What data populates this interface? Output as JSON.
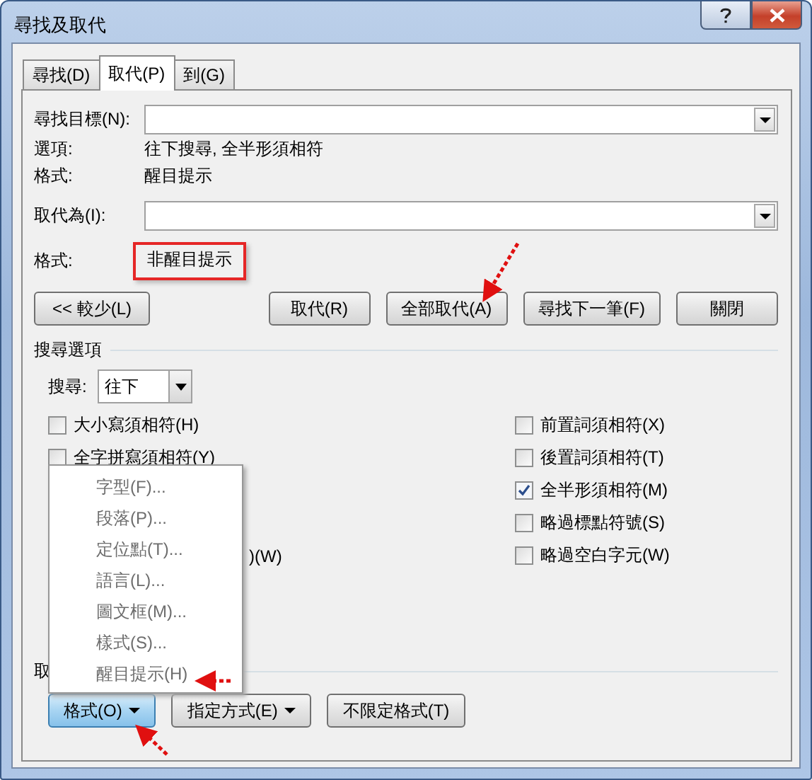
{
  "window": {
    "title": "尋找及取代"
  },
  "tabs": [
    {
      "label": "尋找(D)",
      "selected": false
    },
    {
      "label": "取代(P)",
      "selected": true
    },
    {
      "label": "到(G)",
      "selected": false
    }
  ],
  "find": {
    "label": "尋找目標(N):",
    "options_label": "選項:",
    "options_value": "往下搜尋, 全半形須相符",
    "format_label": "格式:",
    "format_value": "醒目提示"
  },
  "replace": {
    "label": "取代為(I):",
    "format_label": "格式:",
    "format_value": "非醒目提示",
    "format_highlighted": true
  },
  "buttons_left": [
    "<< 較少(L)"
  ],
  "buttons_right": [
    "取代(R)",
    "全部取代(A)",
    "尋找下一筆(F)",
    "關閉"
  ],
  "search_options": {
    "title": "搜尋選項",
    "search_label": "搜尋:",
    "search_value": "往下",
    "left": [
      {
        "kind": "checkbox",
        "label": "大小寫須相符(H)",
        "checked": false
      },
      {
        "kind": "checkbox",
        "label": "全字拼寫須相符(Y)",
        "checked": false
      },
      {
        "kind": "empty"
      },
      {
        "kind": "empty"
      },
      {
        "kind": "fragment",
        "label": ")(W)"
      }
    ],
    "right": [
      {
        "label": "前置詞須相符(X)",
        "checked": false
      },
      {
        "label": "後置詞須相符(T)",
        "checked": false
      },
      {
        "label": "全半形須相符(M)",
        "checked": true
      },
      {
        "label": "略過標點符號(S)",
        "checked": false
      },
      {
        "label": "略過空白字元(W)",
        "checked": false
      }
    ]
  },
  "replace_section": {
    "label": "取"
  },
  "bottom_buttons": [
    {
      "label": "格式(O)",
      "dropdown": true,
      "open": true
    },
    {
      "label": "指定方式(E)",
      "dropdown": true,
      "open": false
    },
    {
      "label": "不限定格式(T)",
      "dropdown": false,
      "open": false
    }
  ],
  "menu": {
    "items": [
      "字型(F)...",
      "段落(P)...",
      "定位點(T)...",
      "語言(L)...",
      "圖文框(M)...",
      "樣式(S)...",
      "醒目提示(H)"
    ]
  }
}
